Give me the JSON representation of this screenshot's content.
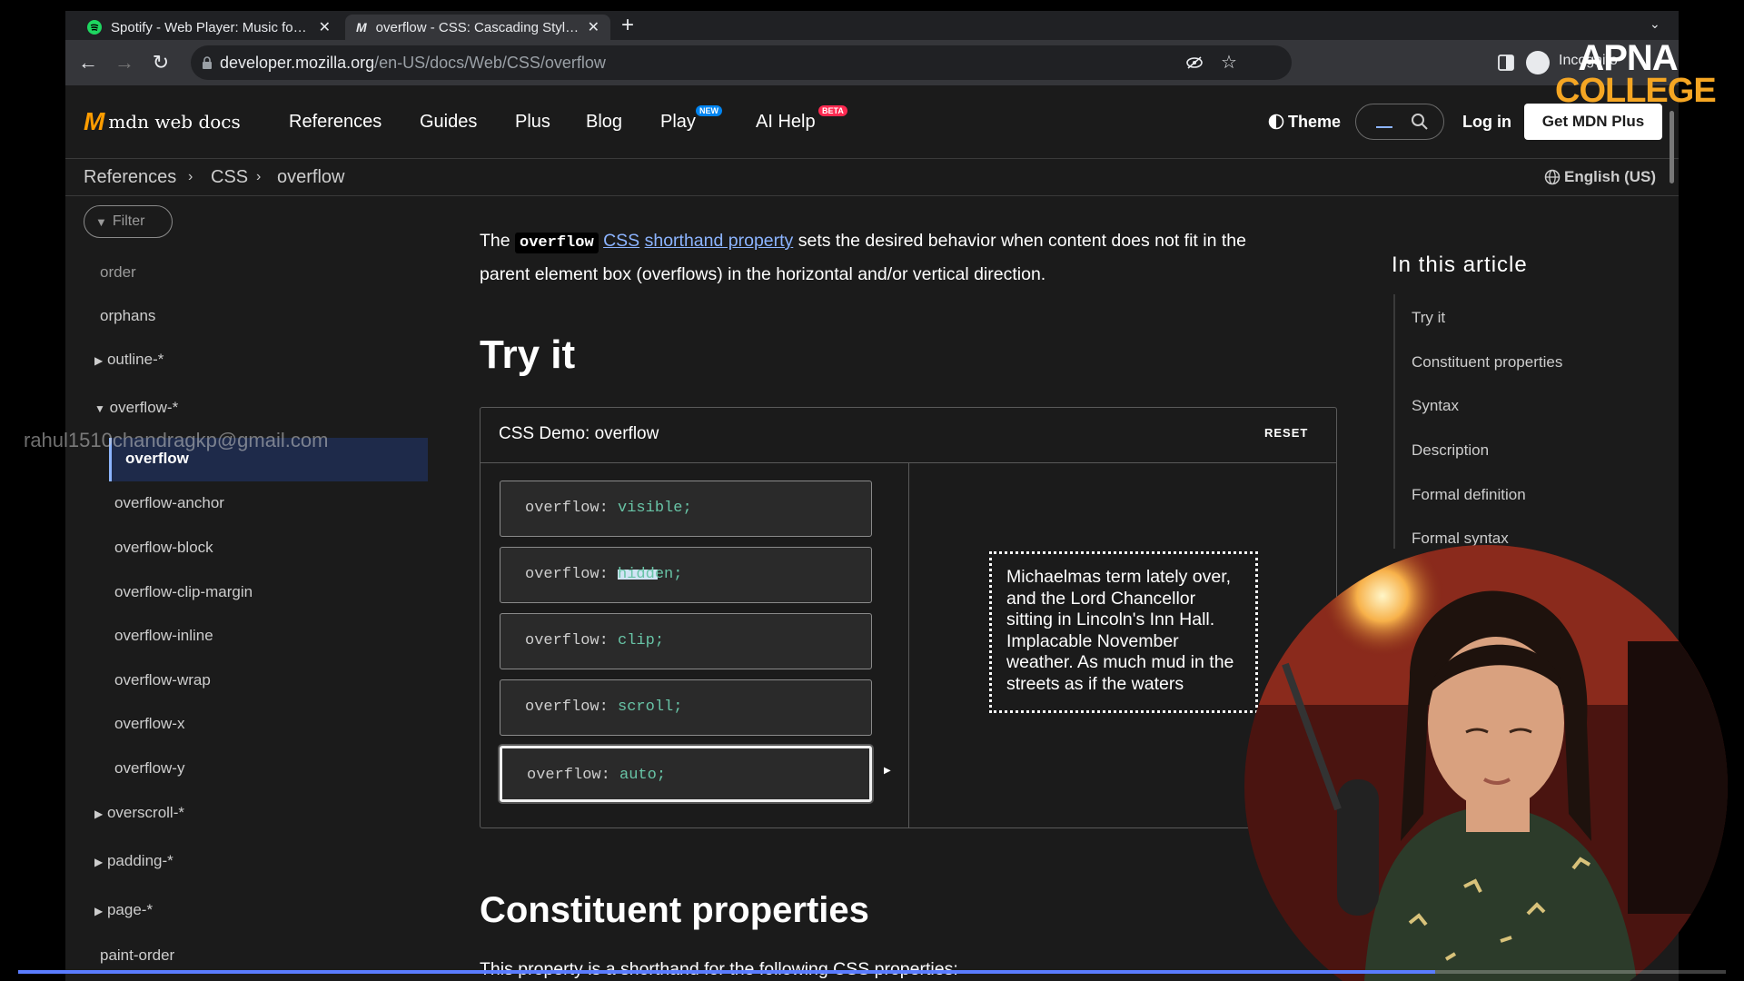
{
  "browser": {
    "tabs": [
      {
        "title": "Spotify - Web Player: Music for everyone",
        "icon": "spotify-icon"
      },
      {
        "title": "overflow - CSS: Cascading Style Sheets | MDN",
        "icon": "mdn-icon"
      }
    ],
    "url_domain": "developer.mozilla.org",
    "url_path": "/en-US/docs/Web/CSS/overflow",
    "profile_label": "Incognito"
  },
  "mdn": {
    "logo_text": "mdn web docs",
    "nav": [
      "References",
      "Guides",
      "Plus",
      "Blog",
      "Play",
      "AI Help"
    ],
    "play_badge": "NEW",
    "ai_badge": "BETA",
    "theme_label": "Theme",
    "login_label": "Log in",
    "cta_label": "Get MDN Plus"
  },
  "breadcrumbs": [
    "References",
    "CSS",
    "overflow"
  ],
  "language": "English (US)",
  "sidebar": {
    "filter_placeholder": "Filter",
    "items": [
      "order",
      "orphans",
      "outline-*",
      "overflow-*",
      "overflow",
      "overflow-anchor",
      "overflow-block",
      "overflow-clip-margin",
      "overflow-inline",
      "overflow-wrap",
      "overflow-x",
      "overflow-y",
      "overscroll-*",
      "padding-*",
      "page-*",
      "paint-order"
    ]
  },
  "article": {
    "intro_the": "The",
    "intro_code": "overflow",
    "intro_link1": "CSS",
    "intro_link2": "shorthand property",
    "intro_rest1": "sets the desired behavior when content does not fit in the",
    "intro_rest2": "parent element box (overflows) in the horizontal and/or vertical direction.",
    "try_it": "Try it",
    "demo_title": "CSS Demo: overflow",
    "reset": "RESET",
    "demo_prop": "overflow:",
    "demo_values": [
      "visible;",
      "hidden;",
      "clip;",
      "scroll;",
      "auto;"
    ],
    "demo_text": "Michaelmas term lately over, and the Lord Chancellor sitting in Lincoln's Inn Hall. Implacable November weather. As much mud in the streets as if the waters",
    "heading2": "Constituent properties",
    "para2": "This property is a shorthand for the following CSS properties:"
  },
  "toc": {
    "title": "In this article",
    "items": [
      "Try it",
      "Constituent properties",
      "Syntax",
      "Description",
      "Formal definition",
      "Formal syntax"
    ]
  },
  "watermark": {
    "email": "rahul1510chandragkp@gmail.com",
    "logo_line1": "APNA",
    "logo_line2": "COLLEGE"
  },
  "colors": {
    "mdn_link": "#8cb4ff",
    "demo_value": "#68c4a6",
    "accent_badge": "#ff2a51",
    "cta_bg": "#ffffff"
  }
}
